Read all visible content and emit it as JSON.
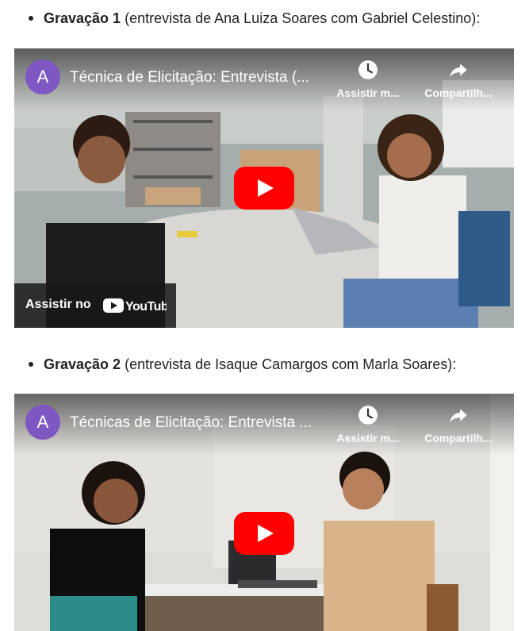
{
  "items": [
    {
      "bold": "Gravação 1",
      "rest": " (entrevista de Ana Luiza Soares com Gabriel Celestino):"
    },
    {
      "bold": "Gravação 2",
      "rest": " (entrevista de Isaque Camargos com Marla Soares):"
    }
  ],
  "videos": [
    {
      "avatar": "A",
      "title": "Técnica de Elicitação: Entrevista (...",
      "watch_later": "Assistir m...",
      "share": "Compartilh...",
      "watch_on": "Assistir no",
      "brand": "YouTube"
    },
    {
      "avatar": "A",
      "title": "Técnicas de Elicitação: Entrevista ...",
      "watch_later": "Assistir m...",
      "share": "Compartilh..."
    }
  ],
  "colors": {
    "play_red": "#ff0000",
    "avatar": "#7e57c2"
  },
  "icons": [
    "clock-icon",
    "share-icon",
    "play-icon",
    "youtube-logo"
  ]
}
